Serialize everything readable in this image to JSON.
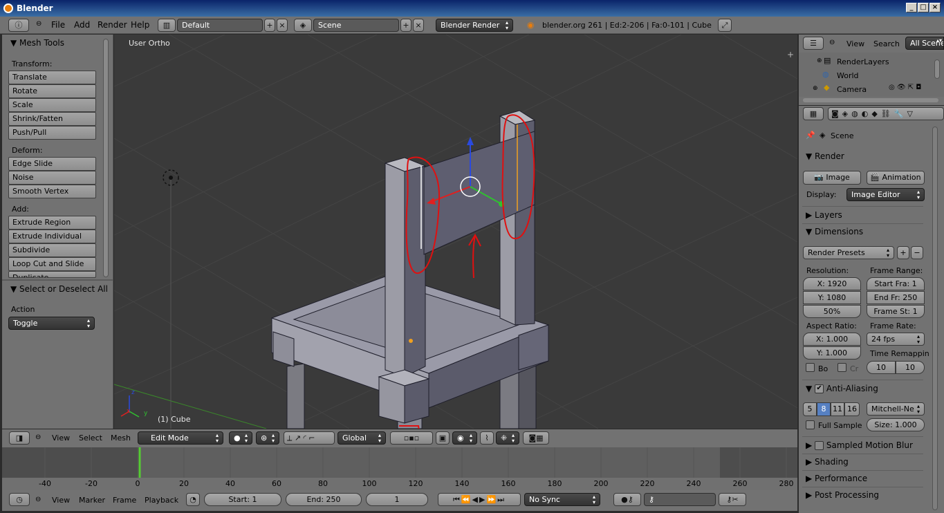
{
  "window": {
    "title": "Blender"
  },
  "menubar": {
    "items": [
      "File",
      "Add",
      "Render",
      "Help"
    ],
    "screen_layout": "Default",
    "scene": "Scene",
    "render_engine": "Blender Render",
    "stats": "blender.org 261 | Ed:2-206 | Fa:0-101 | Cube"
  },
  "toolshelf": {
    "title": "Mesh Tools",
    "transform_label": "Transform:",
    "transform": [
      "Translate",
      "Rotate",
      "Scale",
      "Shrink/Fatten",
      "Push/Pull"
    ],
    "deform_label": "Deform:",
    "deform": [
      "Edge Slide",
      "Noise",
      "Smooth Vertex"
    ],
    "add_label": "Add:",
    "add": [
      "Extrude Region",
      "Extrude Individual",
      "Subdivide",
      "Loop Cut and Slide",
      "Duplicate"
    ],
    "operator_title": "Select or Deselect All",
    "action_label": "Action",
    "action_value": "Toggle"
  },
  "viewport": {
    "view_name": "User Ortho",
    "object_label": "(1) Cube",
    "axis_x": "x",
    "axis_y": "y",
    "axis_z": "z"
  },
  "viewport_header": {
    "menus": [
      "View",
      "Select",
      "Mesh"
    ],
    "mode": "Edit Mode",
    "orientation": "Global"
  },
  "timeline": {
    "ticks": [
      "-40",
      "-20",
      "0",
      "20",
      "40",
      "60",
      "80",
      "100",
      "120",
      "140",
      "160",
      "180",
      "200",
      "220",
      "240",
      "260",
      "280"
    ],
    "current_frame_fraction": 0.168
  },
  "timeline_header": {
    "menus": [
      "View",
      "Marker",
      "Frame",
      "Playback"
    ],
    "start": "Start: 1",
    "end": "End: 250",
    "current": "1",
    "sync": "No Sync"
  },
  "outliner": {
    "menus": [
      "View",
      "Search"
    ],
    "filter": "All Scenes",
    "items": [
      "RenderLayers",
      "World",
      "Camera"
    ]
  },
  "properties": {
    "context": "Scene",
    "render_panel": "Render",
    "image_btn": "Image",
    "animation_btn": "Animation",
    "display_label": "Display:",
    "display_value": "Image Editor",
    "layers": "Layers",
    "dimensions": "Dimensions",
    "render_presets": "Render Presets",
    "resolution_label": "Resolution:",
    "res_x": "X: 1920",
    "res_y": "Y: 1080",
    "res_pct": "50%",
    "frame_range_label": "Frame Range:",
    "start_frame": "Start Fra: 1",
    "end_frame": "End Fr: 250",
    "frame_step": "Frame St: 1",
    "aspect_label": "Aspect Ratio:",
    "aspect_x": "X: 1.000",
    "aspect_y": "Y: 1.000",
    "frame_rate_label": "Frame Rate:",
    "frame_rate": "24 fps",
    "time_remap_label": "Time Remappin",
    "remap_old": "10",
    "remap_new": "10",
    "border_label": "Bo",
    "crop_label": "Cr",
    "anti_aliasing": "Anti-Aliasing",
    "aa_samples": [
      "5",
      "8",
      "11",
      "16"
    ],
    "aa_filter": "Mitchell-Ne",
    "full_sample": "Full Sample",
    "aa_size": "Size: 1.000",
    "sampled_motion_blur": "Sampled Motion Blur",
    "shading": "Shading",
    "performance": "Performance",
    "post_processing": "Post Processing"
  },
  "colors": {
    "header": "#727272",
    "viewport_bg": "#3a3a3a",
    "annotation": "#e01010",
    "accent": "#5680c2",
    "frame_marker": "#55cc33"
  }
}
